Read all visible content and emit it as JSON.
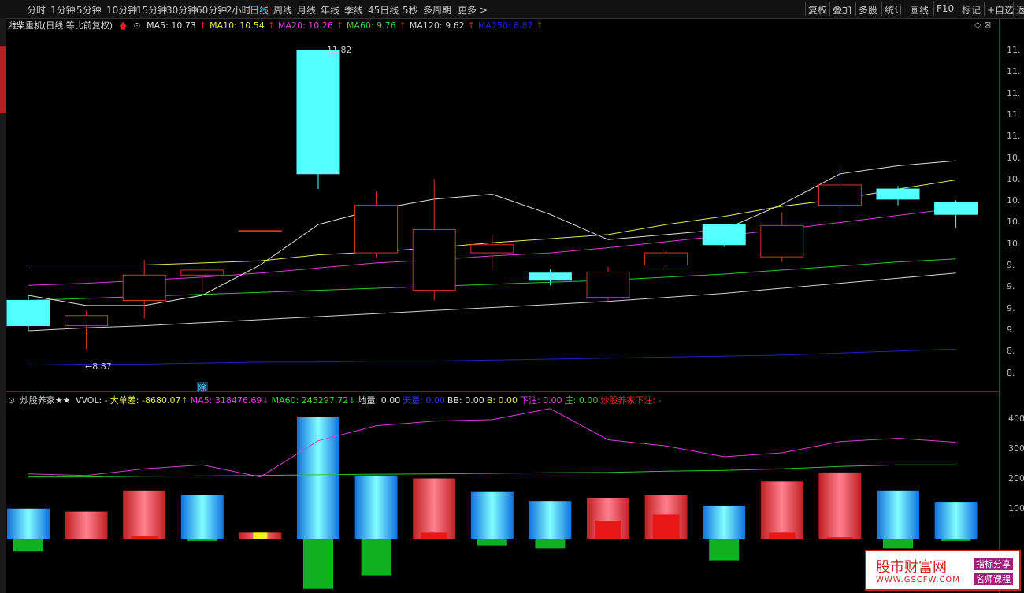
{
  "toolbar": {
    "periods": [
      "分时",
      "1分钟",
      "5分钟",
      "10分钟",
      "15分钟",
      "30分钟",
      "60分钟",
      "2小时",
      "日线",
      "周线",
      "月线",
      "年线",
      "季线",
      "45日线",
      "5秒",
      "多周期",
      "更多 >"
    ],
    "active_period": "日线",
    "actions": [
      "复权",
      "叠加",
      "多股",
      "统计",
      "画线",
      "F10",
      "标记",
      "+自选",
      "返"
    ]
  },
  "main": {
    "stock_title": "潍柴重机(日线 等比前复权)",
    "ma": [
      {
        "label": "MA5: 10.73",
        "arrow": "↑",
        "color": "#e0e0e0"
      },
      {
        "label": "MA10: 10.54",
        "arrow": "↑",
        "color": "#e6e65a"
      },
      {
        "label": "MA20: 10.26",
        "arrow": "↑",
        "color": "#e040e0"
      },
      {
        "label": "MA60: 9.76",
        "arrow": "↑",
        "color": "#40d040"
      },
      {
        "label": "MA120: 9.62",
        "arrow": "↑",
        "color": "#d0d0d0"
      },
      {
        "label": "MA250: 8.87",
        "arrow": "↑",
        "color": "#2020d0"
      }
    ],
    "high_label": "11.82",
    "low_label": "←8.87",
    "marker": "除",
    "price_ticks": [
      "11.",
      "11.",
      "11.",
      "11.",
      "11.",
      "10.",
      "10.",
      "10.",
      "10.",
      "10.",
      "9.",
      "9.",
      "9.",
      "9.",
      "8.",
      "8."
    ]
  },
  "indicator": {
    "name": "炒股养家★★",
    "fields": [
      {
        "label": "VVOL: -",
        "color": "#e0e0e0"
      },
      {
        "label": "大单差: -8680.07↑",
        "color": "#e6e65a"
      },
      {
        "label": "MA5: 318476.69↓",
        "color": "#e040e0"
      },
      {
        "label": "MA60: 245297.72↓",
        "color": "#40d040"
      },
      {
        "label": "地量: 0.00",
        "color": "#e0e0e0"
      },
      {
        "label": "天量: 0.00",
        "color": "#3030e0"
      },
      {
        "label": "BB: 0.00",
        "color": "#e0e0e0"
      },
      {
        "label": "B: 0.00",
        "color": "#e6e65a"
      },
      {
        "label": "下注: 0.00",
        "color": "#e040e0"
      },
      {
        "label": "庄: 0.00",
        "color": "#40d040"
      },
      {
        "label": "炒股养家下注: -",
        "color": "#e03030"
      }
    ],
    "vol_ticks": [
      "400",
      "300",
      "200",
      "100"
    ]
  },
  "watermark": {
    "main": "股市财富网",
    "url": "WWW.GSCFW.COM",
    "tag1": "指标分享",
    "tag2": "名师课程"
  },
  "candles": [
    {
      "o": 9.35,
      "c": 9.1,
      "h": 9.4,
      "l": 9.05
    },
    {
      "o": 9.1,
      "c": 9.2,
      "h": 9.25,
      "l": 8.87
    },
    {
      "o": 9.35,
      "c": 9.6,
      "h": 9.75,
      "l": 9.17
    },
    {
      "o": 9.6,
      "c": 9.65,
      "h": 9.67,
      "l": 9.43
    },
    {
      "o": 10.04,
      "c": 10.04,
      "h": 10.04,
      "l": 10.04
    },
    {
      "o": 11.82,
      "c": 10.6,
      "h": 11.82,
      "l": 10.45
    },
    {
      "o": 9.82,
      "c": 10.29,
      "h": 10.43,
      "l": 9.77
    },
    {
      "o": 9.45,
      "c": 10.05,
      "h": 10.55,
      "l": 9.35
    },
    {
      "o": 9.82,
      "c": 9.9,
      "h": 10.0,
      "l": 9.65
    },
    {
      "o": 9.62,
      "c": 9.55,
      "h": 9.66,
      "l": 9.5
    },
    {
      "o": 9.38,
      "c": 9.63,
      "h": 9.68,
      "l": 9.35
    },
    {
      "o": 9.7,
      "c": 9.82,
      "h": 9.84,
      "l": 9.68
    },
    {
      "o": 10.1,
      "c": 9.9,
      "h": 10.1,
      "l": 9.88
    },
    {
      "o": 9.78,
      "c": 10.09,
      "h": 10.22,
      "l": 9.73
    },
    {
      "o": 10.29,
      "c": 10.49,
      "h": 10.66,
      "l": 10.2
    },
    {
      "o": 10.45,
      "c": 10.35,
      "h": 10.48,
      "l": 10.29
    },
    {
      "o": 10.32,
      "c": 10.2,
      "h": 10.34,
      "l": 10.07
    }
  ],
  "ma5": [
    9.4,
    9.3,
    9.3,
    9.4,
    9.7,
    10.1,
    10.25,
    10.35,
    10.4,
    10.2,
    9.95,
    10.0,
    10.05,
    10.3,
    10.6,
    10.68,
    10.73
  ],
  "ma10": [
    9.7,
    9.7,
    9.7,
    9.72,
    9.74,
    9.8,
    9.83,
    9.87,
    9.92,
    9.96,
    10.0,
    10.1,
    10.18,
    10.28,
    10.35,
    10.45,
    10.54
  ],
  "ma20": [
    9.5,
    9.52,
    9.55,
    9.58,
    9.62,
    9.67,
    9.72,
    9.75,
    9.79,
    9.82,
    9.87,
    9.93,
    9.99,
    10.05,
    10.12,
    10.19,
    10.26
  ],
  "ma60": [
    9.35,
    9.37,
    9.39,
    9.41,
    9.43,
    9.45,
    9.47,
    9.49,
    9.51,
    9.53,
    9.55,
    9.58,
    9.61,
    9.65,
    9.69,
    9.73,
    9.76
  ],
  "ma120": [
    9.05,
    9.08,
    9.1,
    9.13,
    9.16,
    9.19,
    9.22,
    9.25,
    9.28,
    9.31,
    9.34,
    9.38,
    9.42,
    9.47,
    9.52,
    9.57,
    9.62
  ],
  "ma250": [
    8.71,
    8.72,
    8.72,
    8.73,
    8.74,
    8.74,
    8.75,
    8.75,
    8.76,
    8.77,
    8.78,
    8.79,
    8.8,
    8.81,
    8.83,
    8.85,
    8.87
  ],
  "vol": [
    {
      "v": 100,
      "neg": 40,
      "up": false,
      "core": 0
    },
    {
      "v": 90,
      "neg": 0,
      "up": true,
      "core": 0
    },
    {
      "v": 160,
      "neg": 0,
      "up": true,
      "core": 10
    },
    {
      "v": 145,
      "neg": 5,
      "up": false,
      "core": 0
    },
    {
      "v": 20,
      "neg": 0,
      "up": true,
      "core": 20
    },
    {
      "v": 405,
      "neg": 165,
      "up": false,
      "core": 0
    },
    {
      "v": 210,
      "neg": 120,
      "up": false,
      "core": 0
    },
    {
      "v": 200,
      "neg": 0,
      "up": true,
      "core": 20
    },
    {
      "v": 155,
      "neg": 20,
      "up": false,
      "core": 0
    },
    {
      "v": 125,
      "neg": 30,
      "up": false,
      "core": 0
    },
    {
      "v": 135,
      "neg": 0,
      "up": true,
      "core": 60
    },
    {
      "v": 145,
      "neg": 0,
      "up": true,
      "core": 80
    },
    {
      "v": 110,
      "neg": 70,
      "up": false,
      "core": 0
    },
    {
      "v": 190,
      "neg": 0,
      "up": true,
      "core": 20
    },
    {
      "v": 220,
      "neg": 0,
      "up": true,
      "core": 5
    },
    {
      "v": 160,
      "neg": 30,
      "up": false,
      "core": 0
    },
    {
      "v": 120,
      "neg": 5,
      "up": false,
      "core": 0
    }
  ],
  "vol_ma5": [
    215,
    210,
    232,
    245,
    205,
    325,
    375,
    390,
    395,
    432,
    328,
    308,
    272,
    285,
    322,
    333,
    320
  ],
  "vol_ma60": [
    205,
    205,
    207,
    208,
    210,
    212,
    214,
    215,
    217,
    219,
    220,
    224,
    227,
    232,
    240,
    245,
    245
  ]
}
